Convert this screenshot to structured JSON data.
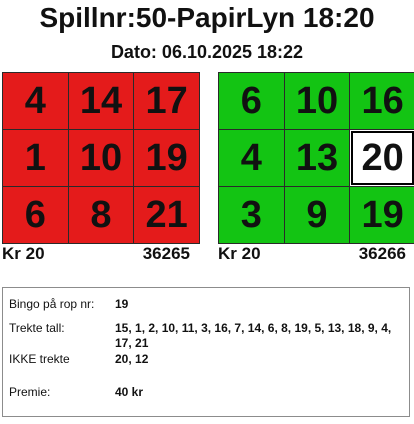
{
  "header": {
    "title": "Spillnr:50-PapirLyn 18:20",
    "date": "Dato: 06.10.2025 18:22"
  },
  "cards": [
    {
      "color": "#e41b1b",
      "numbers": [
        "4",
        "14",
        "17",
        "1",
        "10",
        "19",
        "6",
        "8",
        "21"
      ],
      "price": "Kr 20",
      "serial": "36265"
    },
    {
      "color": "#13c413",
      "numbers": [
        "6",
        "10",
        "16",
        "4",
        "13",
        "20",
        "3",
        "9",
        "19"
      ],
      "highlighted_number": "20",
      "price": "Kr 20",
      "serial": "36266"
    }
  ],
  "result": {
    "bingo_label": "Bingo på rop nr:",
    "bingo_value": "19",
    "drawn_label": "Trekte tall:",
    "drawn_value": "15, 1, 2, 10, 11, 3, 16, 7, 14, 6, 8, 19, 5, 13, 18, 9, 4, 17, 21",
    "not_drawn_label": "IKKE trekte",
    "not_drawn_value": "20, 12",
    "prize_label": "Premie:",
    "prize_value": "40 kr"
  }
}
